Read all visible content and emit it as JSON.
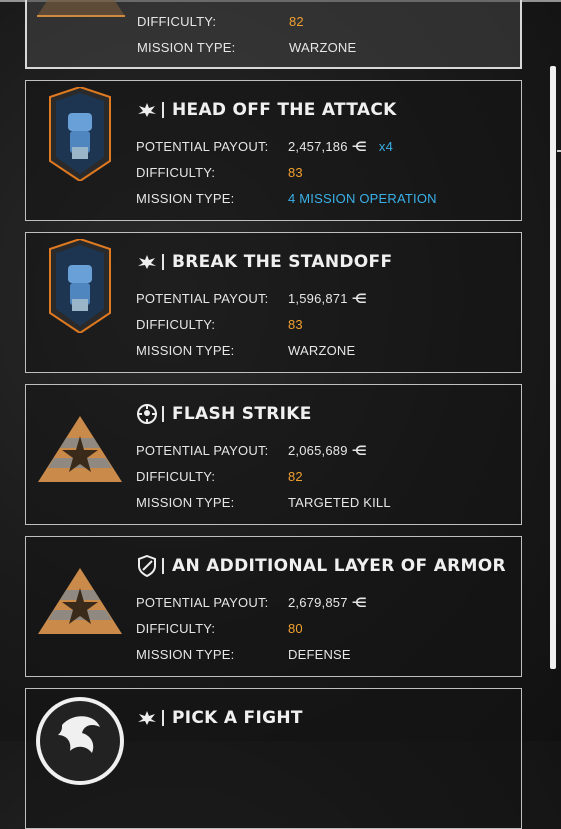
{
  "labels": {
    "payout": "POTENTIAL PAYOUT:",
    "difficulty": "DIFFICULTY:",
    "type": "MISSION TYPE:",
    "currency_symbol": "⋲"
  },
  "missions": [
    {
      "difficulty": "82",
      "type": "WARZONE"
    },
    {
      "title": "HEAD OFF THE ATTACK",
      "payout": "2,457,186",
      "multiplier": "x4",
      "difficulty": "83",
      "type": "4 MISSION OPERATION"
    },
    {
      "title": "BREAK THE STANDOFF",
      "payout": "1,596,871",
      "difficulty": "83",
      "type": "WARZONE"
    },
    {
      "title": "FLASH STRIKE",
      "payout": "2,065,689",
      "difficulty": "82",
      "type": "TARGETED KILL"
    },
    {
      "title": "AN ADDITIONAL LAYER OF ARMOR",
      "payout": "2,679,857",
      "difficulty": "80",
      "type": "DEFENSE"
    },
    {
      "title": "PICK A FIGHT"
    }
  ],
  "colors": {
    "accent_orange": "#f0a030",
    "accent_blue": "#3ab0e8"
  }
}
